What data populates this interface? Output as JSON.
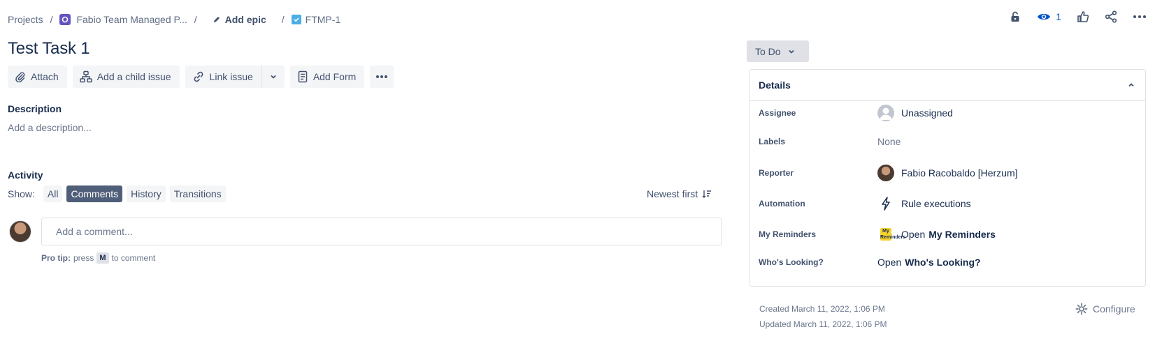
{
  "breadcrumb": {
    "projects": "Projects",
    "separator": "/",
    "project_name": "Fabio Team Managed P...",
    "add_epic": "Add epic",
    "issue_key": "FTMP-1"
  },
  "header_actions": {
    "watch_count": "1",
    "icons": [
      "lock-icon",
      "eye-icon",
      "thumbs-up-icon",
      "share-icon",
      "more-icon"
    ]
  },
  "issue": {
    "title": "Test Task 1"
  },
  "toolbar": {
    "attach": "Attach",
    "add_child": "Add a child issue",
    "link_issue": "Link issue",
    "add_form": "Add Form"
  },
  "description": {
    "label": "Description",
    "placeholder": "Add a description..."
  },
  "activity": {
    "label": "Activity",
    "show_label": "Show:",
    "filters": [
      "All",
      "Comments",
      "History",
      "Transitions"
    ],
    "active_filter": "Comments",
    "sort": "Newest first"
  },
  "comment": {
    "placeholder": "Add a comment...",
    "pro_tip_label": "Pro tip:",
    "pro_tip_press": "press",
    "pro_tip_key": "M",
    "pro_tip_suffix": "to comment"
  },
  "status": {
    "label": "To Do"
  },
  "details": {
    "heading": "Details",
    "rows": {
      "assignee": {
        "label": "Assignee",
        "value": "Unassigned"
      },
      "labels": {
        "label": "Labels",
        "value": "None"
      },
      "reporter": {
        "label": "Reporter",
        "value": "Fabio Racobaldo [Herzum]"
      },
      "automation": {
        "label": "Automation",
        "value": "Rule executions"
      },
      "reminders": {
        "label": "My Reminders",
        "prefix": "Open",
        "value": "My Reminders",
        "icon_text": "My Reminders"
      },
      "looking": {
        "label": "Who's Looking?",
        "prefix": "Open",
        "value": "Who's Looking?"
      }
    }
  },
  "meta": {
    "created": "Created March 11, 2022, 1:06 PM",
    "updated": "Updated March 11, 2022, 1:06 PM",
    "configure": "Configure"
  },
  "colors": {
    "primary_text": "#172b4d",
    "secondary_text": "#42526e",
    "muted_text": "#6b778c",
    "button_bg": "#f4f5f7",
    "active_pill": "#505f79",
    "link_blue": "#0052cc",
    "project_avatar": "#6554c0",
    "task_icon": "#4bade8"
  }
}
